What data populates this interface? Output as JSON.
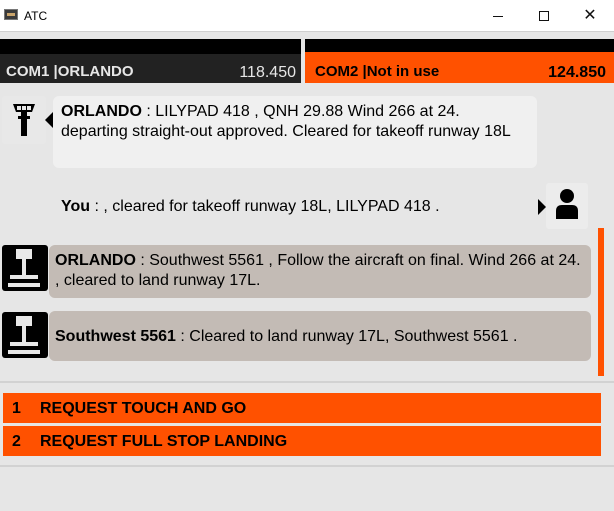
{
  "window": {
    "title": "ATC"
  },
  "com1": {
    "label": "COM1 |ORLANDO",
    "freq": "118.450"
  },
  "com2": {
    "label": "COM2 |Not in use",
    "freq": "124.850"
  },
  "messages": [
    {
      "sender": "ORLANDO",
      "text": " : LILYPAD 418 , QNH 29.88 Wind 266 at 24. departing straight-out approved. Cleared for takeoff runway 18L"
    },
    {
      "sender": "You",
      "text": " : , cleared for takeoff runway 18L, LILYPAD 418 ."
    },
    {
      "sender": "ORLANDO",
      "text": " : Southwest 5561 , Follow the aircraft on final. Wind 266 at 24. , cleared to land runway 17L."
    },
    {
      "sender": "Southwest 5561",
      "text": " : Cleared to land runway 17L, Southwest 5561 ."
    }
  ],
  "options": [
    {
      "num": "1",
      "label": "REQUEST TOUCH AND GO"
    },
    {
      "num": "2",
      "label": "REQUEST FULL STOP LANDING"
    }
  ],
  "colors": {
    "accent": "#ff5100",
    "atc_bubble": "#c3bbb5",
    "dark": "#000000"
  }
}
